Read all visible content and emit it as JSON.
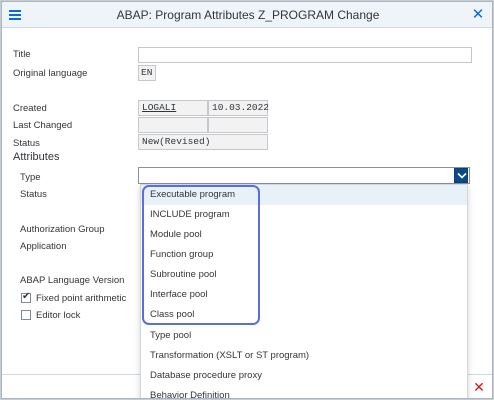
{
  "window": {
    "title": "ABAP: Program Attributes Z_PROGRAM Change",
    "menu_icon": "hamburger-menu-icon",
    "close_icon": "close-x-icon"
  },
  "header_fields": {
    "title_label": "Title",
    "title_value": "",
    "original_language_label": "Original language",
    "original_language_value": "EN"
  },
  "info_fields": {
    "created_label": "Created",
    "created_by": "LOGALI",
    "created_date": "10.03.2022",
    "last_changed_label": "Last Changed",
    "last_changed_by": "",
    "last_changed_date": "",
    "status_label": "Status",
    "status_value": "New(Revised)"
  },
  "attributes": {
    "section_title": "Attributes",
    "type_label": "Type",
    "type_value": "",
    "status_label": "Status",
    "authorization_group_label": "Authorization Group",
    "application_label": "Application",
    "abap_language_version_label": "ABAP Language Version",
    "fixed_point_label": "Fixed point arithmetic",
    "fixed_point_checked": true,
    "editor_lock_label": "Editor lock",
    "editor_lock_checked": false
  },
  "type_dropdown": {
    "options": [
      "Executable program",
      "INCLUDE program",
      "Module pool",
      "Function group",
      "Subroutine pool",
      "Interface pool",
      "Class pool",
      "Type pool",
      "Transformation (XSLT or ST program)",
      "Database procedure proxy",
      "Behavior Definition"
    ],
    "selected_index": 0,
    "highlight_color": "#5b6fd9"
  },
  "colors": {
    "accent": "#0a6ed1",
    "cancel": "#cc1919"
  },
  "footer": {
    "cancel_icon": "cancel-x-icon"
  }
}
